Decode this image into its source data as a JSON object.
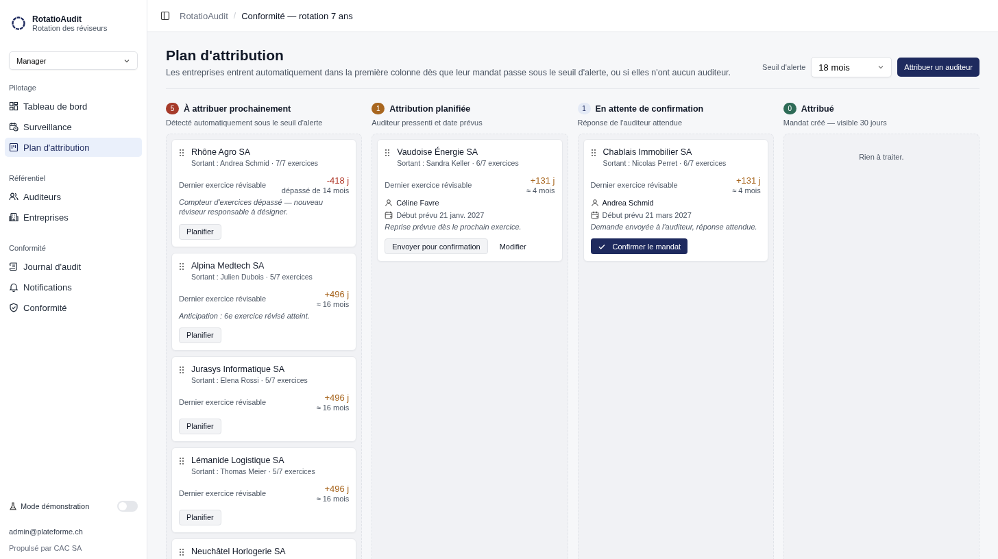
{
  "app": {
    "name": "RotatioAudit",
    "tagline": "Rotation des réviseurs"
  },
  "role_select": {
    "value": "Manager"
  },
  "nav_sections": [
    {
      "title": "Pilotage",
      "items": [
        {
          "label": "Tableau de bord",
          "kind": "dashboard",
          "selected": false
        },
        {
          "label": "Surveillance",
          "kind": "calendar",
          "selected": false
        },
        {
          "label": "Plan d'attribution",
          "kind": "board",
          "selected": true
        }
      ]
    },
    {
      "title": "Référentiel",
      "items": [
        {
          "label": "Auditeurs",
          "kind": "users",
          "selected": false
        },
        {
          "label": "Entreprises",
          "kind": "building",
          "selected": false
        }
      ]
    },
    {
      "title": "Conformité",
      "items": [
        {
          "label": "Journal d'audit",
          "kind": "journal",
          "selected": false
        },
        {
          "label": "Notifications",
          "kind": "bell",
          "selected": false
        },
        {
          "label": "Conformité",
          "kind": "shield",
          "selected": false
        }
      ]
    }
  ],
  "demo_mode": {
    "label": "Mode démonstration",
    "on": false
  },
  "user_email": "admin@plateforme.ch",
  "footer": "Propulsé par CAC SA",
  "breadcrumb": {
    "separator": "/",
    "items": [
      "RotatioAudit",
      "Conformité — rotation 7 ans"
    ]
  },
  "page": {
    "title": "Plan d'attribution",
    "subtitle": "Les entreprises entrent automatiquement dans la première colonne dès que leur mandat passe sous le seuil d'alerte, ou si elles n'ont aucun auditeur.",
    "threshold_label": "Seuil d'alerte",
    "threshold_value": "18 mois",
    "primary_action": "Attribuer un auditeur"
  },
  "columns": [
    {
      "title": "À attribuer prochainement",
      "count": "5",
      "color": "#a63a2a",
      "subtitle": "Détecté automatiquement sous le seuil d'alerte",
      "cards": [
        {
          "company": "Rhône Agro SA",
          "outgoing": "Sortant : Andrea Schmid · 7/7 exercices",
          "metric_label": "Dernier exercice révisable",
          "delta": "-418 j",
          "kind": "overdue",
          "delta_note": "dépassé de 14 mois",
          "note": "Compteur d'exercices dépassé — nouveau réviseur responsable à désigner.",
          "actions": [
            {
              "label": "Planifier",
              "kind": "secondary"
            }
          ]
        },
        {
          "company": "Alpina Medtech SA",
          "outgoing": "Sortant : Julien Dubois · 5/7 exercices",
          "metric_label": "Dernier exercice révisable",
          "delta": "+496 j",
          "kind": "upcoming",
          "delta_note": "≈ 16 mois",
          "note": "Anticipation : 6e exercice révisé atteint.",
          "actions": [
            {
              "label": "Planifier",
              "kind": "secondary"
            }
          ]
        },
        {
          "company": "Jurasys Informatique SA",
          "outgoing": "Sortant : Elena Rossi · 5/7 exercices",
          "metric_label": "Dernier exercice révisable",
          "delta": "+496 j",
          "kind": "upcoming",
          "delta_note": "≈ 16 mois",
          "actions": [
            {
              "label": "Planifier",
              "kind": "secondary"
            }
          ]
        },
        {
          "company": "Lémanide Logistique SA",
          "outgoing": "Sortant : Thomas Meier · 5/7 exercices",
          "metric_label": "Dernier exercice révisable",
          "delta": "+496 j",
          "kind": "upcoming",
          "delta_note": "≈ 16 mois",
          "actions": [
            {
              "label": "Planifier",
              "kind": "secondary"
            }
          ]
        },
        {
          "company": "Neuchâtel Horlogerie SA"
        }
      ]
    },
    {
      "title": "Attribution planifiée",
      "count": "1",
      "color": "#a8661f",
      "subtitle": "Auditeur pressenti et date prévus",
      "cards": [
        {
          "company": "Vaudoise Énergie SA",
          "outgoing": "Sortant : Sandra Keller · 6/7 exercices",
          "metric_label": "Dernier exercice révisable",
          "delta": "+131 j",
          "kind": "upcoming",
          "delta_note": "≈ 4 mois",
          "auditor": "Céline Favre",
          "start": "Début prévu 21 janv. 2027",
          "note": "Reprise prévue dès le prochain exercice.",
          "actions": [
            {
              "label": "Envoyer pour confirmation",
              "kind": "secondary"
            },
            {
              "label": "Modifier",
              "kind": "ghost"
            }
          ]
        }
      ]
    },
    {
      "title": "En attente de confirmation",
      "count": "1",
      "color": "#e4eaf6",
      "subtitle": "Réponse de l'auditeur attendue",
      "cards": [
        {
          "company": "Chablais Immobilier SA",
          "outgoing": "Sortant : Nicolas Perret · 6/7 exercices",
          "metric_label": "Dernier exercice révisable",
          "delta": "+131 j",
          "kind": "upcoming",
          "delta_note": "≈ 4 mois",
          "auditor": "Andrea Schmid",
          "start": "Début prévu 21 mars 2027",
          "note": "Demande envoyée à l'auditeur, réponse attendue.",
          "actions": [
            {
              "label": "Confirmer le mandat",
              "kind": "primary"
            }
          ]
        }
      ]
    },
    {
      "title": "Attribué",
      "count": "0",
      "color": "#2e6b57",
      "subtitle": "Mandat créé — visible 30 jours",
      "empty_text": "Rien à traiter."
    }
  ]
}
